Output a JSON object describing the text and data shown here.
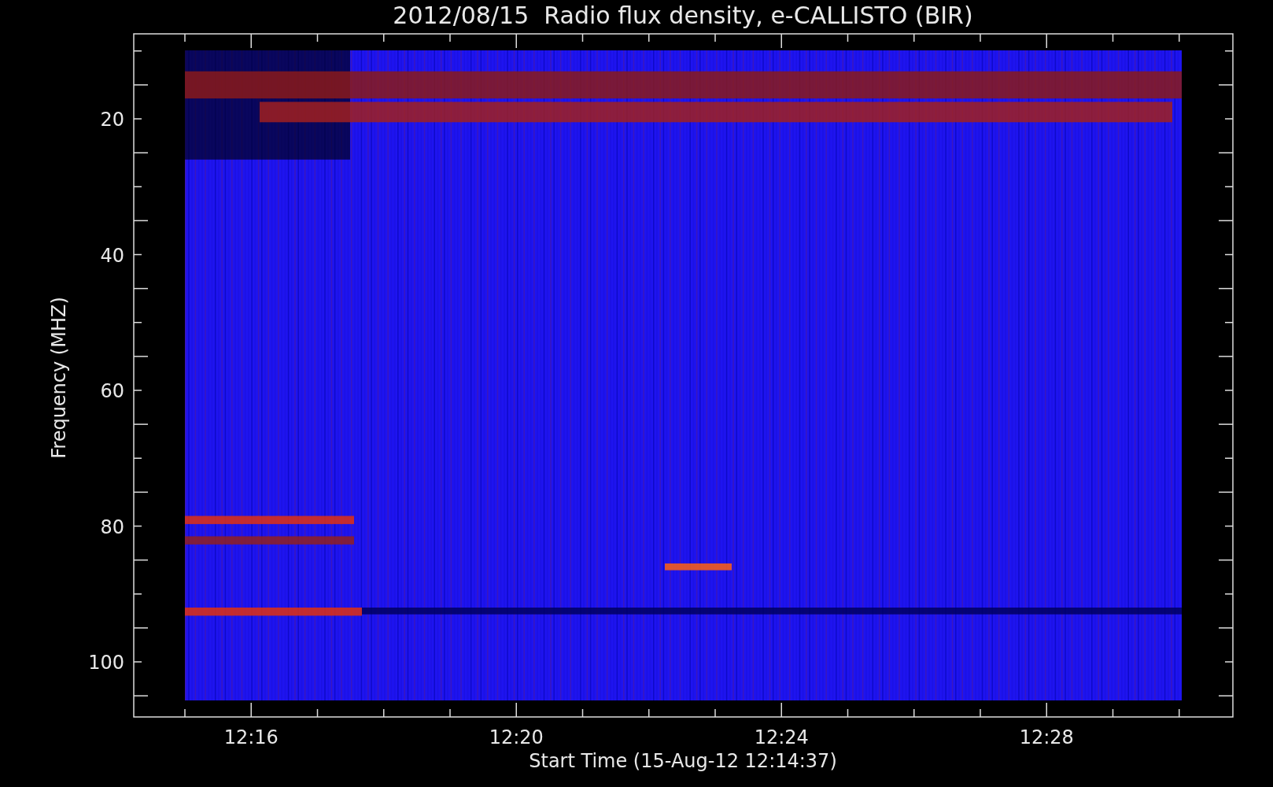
{
  "title": "2012/08/15  Radio flux density, e-CALLISTO (BIR)",
  "y_axis": {
    "label": "Frequency (MHZ)",
    "ticks": [
      "20",
      "40",
      "60",
      "80",
      "100"
    ]
  },
  "x_axis": {
    "label": "Start Time (15-Aug-12 12:14:37)",
    "ticks": [
      "12:16",
      "12:20",
      "12:24",
      "12:28"
    ]
  }
}
